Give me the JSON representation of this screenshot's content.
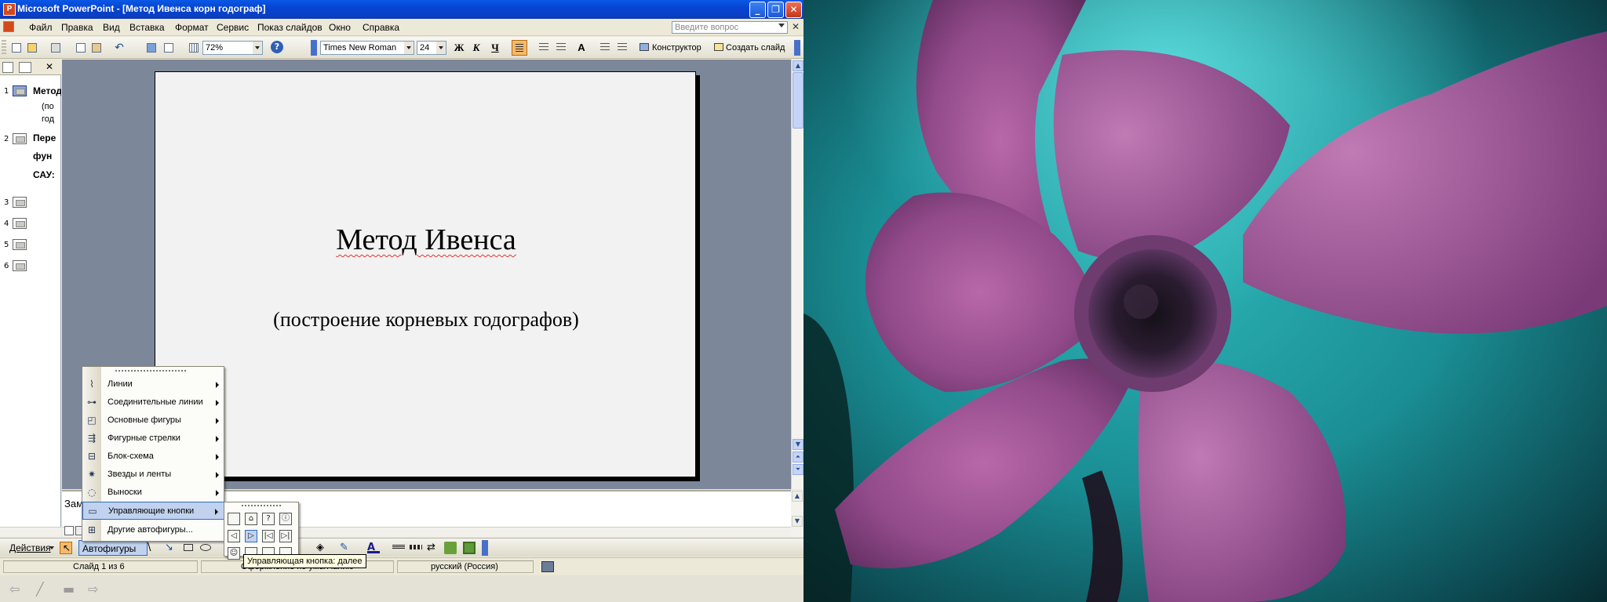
{
  "window": {
    "title": "Microsoft PowerPoint - [Метод Ивенса корн годограф]",
    "app_icon_glyph": "P",
    "minimize_glyph": "_",
    "maximize_glyph": "❐",
    "close_glyph": "✕"
  },
  "menubar": {
    "items": [
      "Файл",
      "Правка",
      "Вид",
      "Вставка",
      "Формат",
      "Сервис",
      "Показ слайдов",
      "Окно",
      "Справка"
    ],
    "ask_placeholder": "Введите вопрос",
    "doc_close_glyph": "✕"
  },
  "toolbar": {
    "zoom": "72%",
    "font_name": "Times New Roman",
    "font_size": "24",
    "bold_glyph": "Ж",
    "italic_glyph": "К",
    "underline_glyph": "Ч",
    "designer_label": "Конструктор",
    "new_slide_label": "Создать слайд",
    "help_glyph": "?",
    "grow_font_glyph": "A"
  },
  "outline": {
    "close_glyph": "✕",
    "slides": [
      {
        "num": "1",
        "title": "Метод",
        "lines": [
          "(по",
          "год"
        ]
      },
      {
        "num": "2",
        "title": "Пере",
        "lines": [
          "фун",
          "САУ:"
        ]
      },
      {
        "num": "3"
      },
      {
        "num": "4"
      },
      {
        "num": "5"
      },
      {
        "num": "6"
      }
    ]
  },
  "slide": {
    "title": "Метод Ивенса",
    "subtitle": "(построение корневых годографов)"
  },
  "notes": {
    "placeholder": "Заме"
  },
  "autoshapes_menu": {
    "items": [
      {
        "label": "Линии",
        "icon": "lines-icon"
      },
      {
        "label": "Соединительные линии",
        "icon": "connectors-icon"
      },
      {
        "label": "Основные фигуры",
        "icon": "basic-shapes-icon"
      },
      {
        "label": "Фигурные стрелки",
        "icon": "block-arrows-icon"
      },
      {
        "label": "Блок-схема",
        "icon": "flowchart-icon"
      },
      {
        "label": "Звезды и ленты",
        "icon": "stars-banners-icon"
      },
      {
        "label": "Выноски",
        "icon": "callouts-icon"
      },
      {
        "label": "Управляющие кнопки",
        "icon": "action-buttons-icon",
        "highlighted": true
      },
      {
        "label": "Другие автофигуры...",
        "icon": "more-autoshapes-icon"
      }
    ]
  },
  "action_buttons": {
    "glyphs": [
      "",
      "⌂",
      "?",
      "ⓘ",
      "◁",
      "▷",
      "|◁",
      "▷|",
      "☺",
      "",
      "",
      ""
    ]
  },
  "tooltip": "Управляющая кнопка: далее",
  "drawing_toolbar": {
    "actions_label": "Действия",
    "autoshapes_label": "Автофигуры"
  },
  "statusbar": {
    "slide_info": "Слайд 1 из 6",
    "design_info": "Оформление по умолчанию",
    "language": "русский (Россия)"
  },
  "colors": {
    "titlebar_blue": "#0a4fd8",
    "menu_highlight": "#c1d2ee",
    "slide_bg": "#f2f2f2",
    "workspace_bg": "#7c879a"
  }
}
